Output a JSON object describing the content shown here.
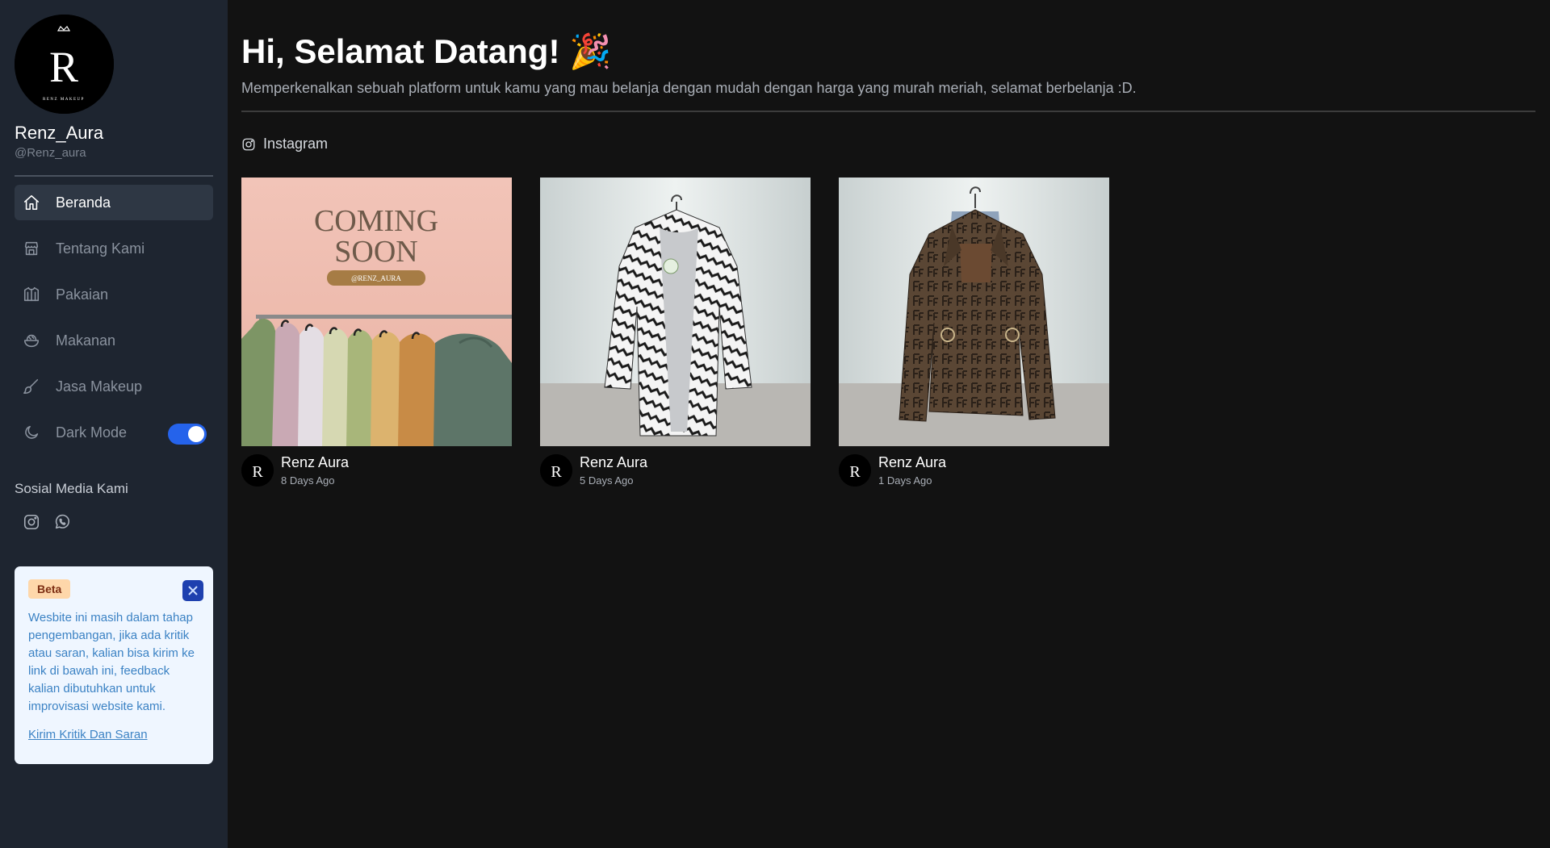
{
  "profile": {
    "name": "Renz_Aura",
    "handle": "@Renz_aura",
    "logo_letter": "R",
    "logo_caption": "RENZ MAKEUP"
  },
  "nav": {
    "items": [
      {
        "label": "Beranda",
        "icon": "home-icon",
        "active": true
      },
      {
        "label": "Tentang Kami",
        "icon": "store-icon",
        "active": false
      },
      {
        "label": "Pakaian",
        "icon": "shirt-icon",
        "active": false
      },
      {
        "label": "Makanan",
        "icon": "bowl-icon",
        "active": false
      },
      {
        "label": "Jasa Makeup",
        "icon": "brush-icon",
        "active": false
      },
      {
        "label": "Dark Mode",
        "icon": "moon-icon",
        "active": false,
        "toggle_on": true
      }
    ]
  },
  "social": {
    "title": "Sosial Media Kami",
    "icons": [
      "instagram-icon",
      "whatsapp-icon"
    ]
  },
  "beta": {
    "badge": "Beta",
    "text": "Wesbite ini masih dalam tahap pengembangan, jika ada kritik atau saran, kalian bisa kirim ke link di bawah ini, feedback kalian dibutuhkan untuk improvisasi website kami.",
    "link": "Kirim Kritik Dan Saran"
  },
  "main": {
    "title": "Hi, Selamat Datang! 🎉",
    "subtitle": "Memperkenalkan sebuah platform untuk kamu yang mau belanja dengan mudah dengan harga yang murah meriah, selamat berbelanja :D.",
    "section_label": "Instagram"
  },
  "posts": [
    {
      "author": "Renz Aura",
      "time": "8 Days Ago",
      "image": "coming-soon",
      "poster_line1": "COMING",
      "poster_line2": "SOON",
      "poster_tag": "@RENZ_AURA"
    },
    {
      "author": "Renz Aura",
      "time": "5 Days Ago",
      "image": "zebra-jacket"
    },
    {
      "author": "Renz Aura",
      "time": "1 Days Ago",
      "image": "brown-pattern-jacket"
    }
  ],
  "colors": {
    "sidebar_bg": "#1e2530",
    "main_bg": "#121212",
    "accent": "#2563eb",
    "beta_bg": "#eff6ff"
  }
}
